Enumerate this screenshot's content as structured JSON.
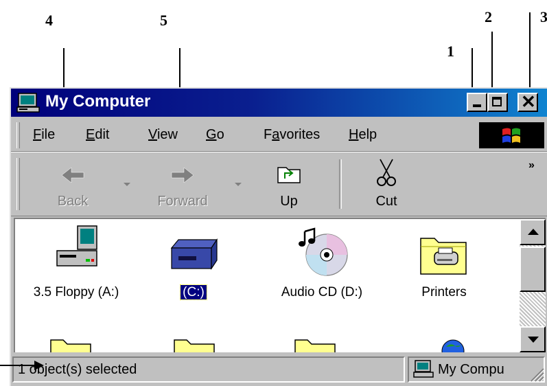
{
  "annotations": [
    "1",
    "2",
    "3",
    "4",
    "5"
  ],
  "window": {
    "title": "My Computer",
    "controls": {
      "minimize": "minimize",
      "maximize": "maximize",
      "close": "close"
    }
  },
  "menubar": {
    "items": [
      {
        "pre": "",
        "key": "F",
        "post": "ile"
      },
      {
        "pre": "",
        "key": "E",
        "post": "dit"
      },
      {
        "pre": "",
        "key": "V",
        "post": "iew"
      },
      {
        "pre": "",
        "key": "G",
        "post": "o"
      },
      {
        "pre": "F",
        "key": "a",
        "post": "vorites"
      },
      {
        "pre": "",
        "key": "H",
        "post": "elp"
      }
    ]
  },
  "toolbar": {
    "back": "Back",
    "forward": "Forward",
    "up": "Up",
    "cut": "Cut",
    "more": "»"
  },
  "content": {
    "items": [
      {
        "label": "3.5 Floppy (A:)",
        "icon": "floppy-drive-icon"
      },
      {
        "label": "(C:)",
        "icon": "hard-drive-icon",
        "selected": true
      },
      {
        "label": "Audio CD (D:)",
        "icon": "audio-cd-icon"
      },
      {
        "label": "Printers",
        "icon": "printers-folder-icon"
      }
    ]
  },
  "statusbar": {
    "selection": "1 object(s) selected",
    "location": "My Compu"
  },
  "colors": {
    "title_start": "#00007b",
    "title_end": "#1084d0",
    "face": "#c0c0c0",
    "selection": "#000080"
  }
}
